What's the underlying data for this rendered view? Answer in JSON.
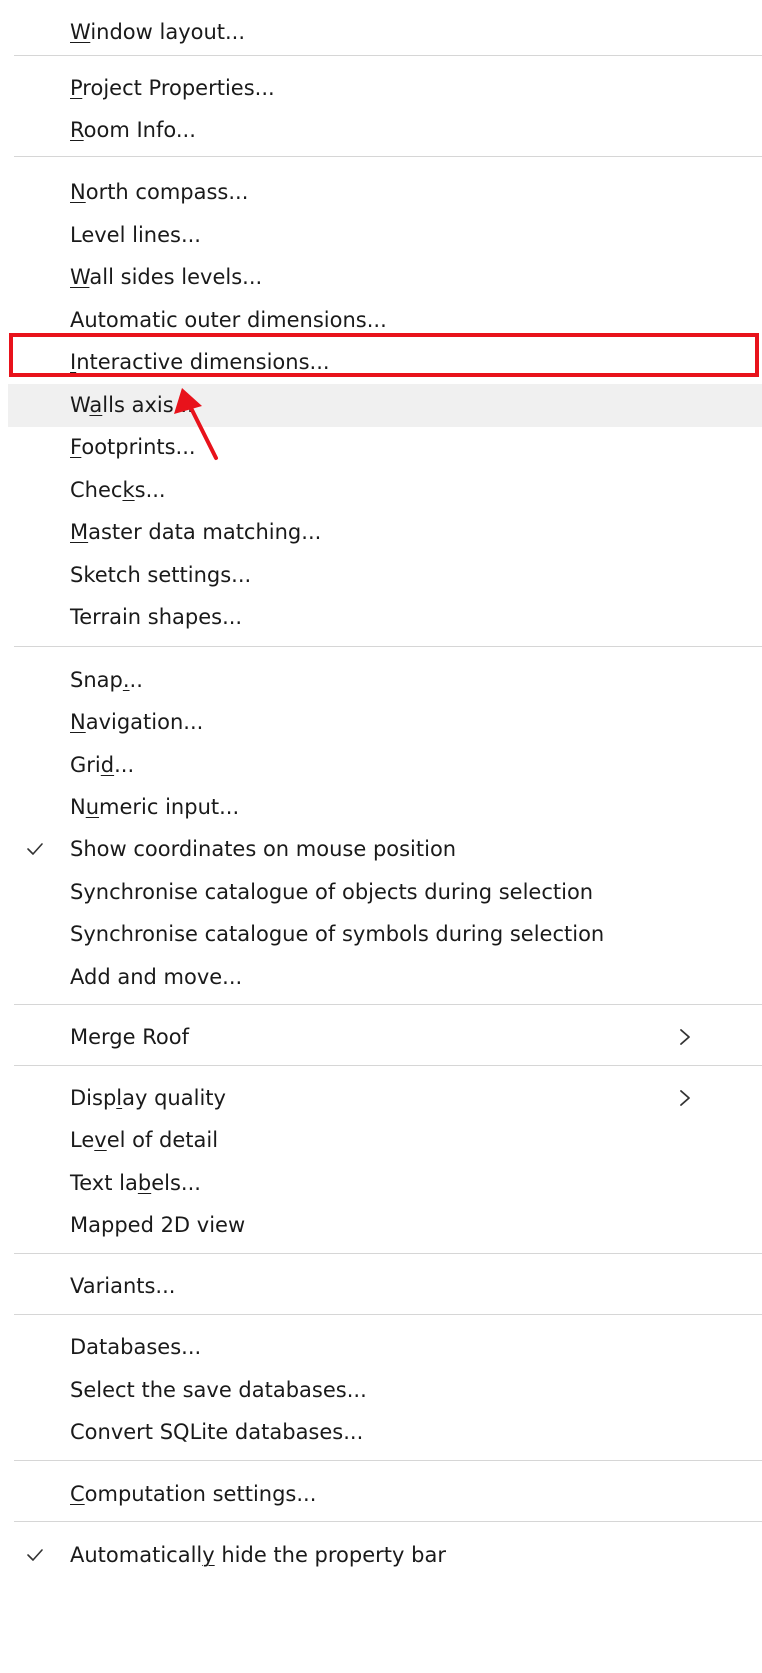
{
  "menu": {
    "items": [
      {
        "pre": "",
        "u": "W",
        "post": "indow layout...",
        "checked": false,
        "submenu": false,
        "hover": false
      },
      {
        "pre": "",
        "u": "P",
        "post": "roject Properties...",
        "checked": false,
        "submenu": false,
        "hover": false
      },
      {
        "pre": "",
        "u": "R",
        "post": "oom Info...",
        "checked": false,
        "submenu": false,
        "hover": false
      },
      {
        "pre": "",
        "u": "N",
        "post": "orth compass...",
        "checked": false,
        "submenu": false,
        "hover": false
      },
      {
        "pre": "Level lines...",
        "u": "",
        "post": "",
        "checked": false,
        "submenu": false,
        "hover": false
      },
      {
        "pre": "",
        "u": "W",
        "post": "all sides levels...",
        "checked": false,
        "submenu": false,
        "hover": false
      },
      {
        "pre": "Automatic outer dimensions...",
        "u": "",
        "post": "",
        "checked": false,
        "submenu": false,
        "hover": false
      },
      {
        "pre": "",
        "u": "I",
        "post": "nteractive dimensions...",
        "checked": false,
        "submenu": false,
        "hover": false
      },
      {
        "pre": "W",
        "u": "a",
        "post": "lls axis...",
        "checked": false,
        "submenu": false,
        "hover": true
      },
      {
        "pre": "",
        "u": "F",
        "post": "ootprints...",
        "checked": false,
        "submenu": false,
        "hover": false
      },
      {
        "pre": "Chec",
        "u": "k",
        "post": "s...",
        "checked": false,
        "submenu": false,
        "hover": false
      },
      {
        "pre": "",
        "u": "M",
        "post": "aster data matching...",
        "checked": false,
        "submenu": false,
        "hover": false
      },
      {
        "pre": "Sketch settings...",
        "u": "",
        "post": "",
        "checked": false,
        "submenu": false,
        "hover": false
      },
      {
        "pre": "Terrain shapes...",
        "u": "",
        "post": "",
        "checked": false,
        "submenu": false,
        "hover": false
      },
      {
        "pre": "Snap",
        "u": ".",
        "post": "..",
        "checked": false,
        "submenu": false,
        "hover": false
      },
      {
        "pre": "",
        "u": "N",
        "post": "avigation...",
        "checked": false,
        "submenu": false,
        "hover": false
      },
      {
        "pre": "Gri",
        "u": "d",
        "post": "...",
        "checked": false,
        "submenu": false,
        "hover": false
      },
      {
        "pre": "N",
        "u": "u",
        "post": "meric input...",
        "checked": false,
        "submenu": false,
        "hover": false
      },
      {
        "pre": "Show coordinates on mouse position",
        "u": "",
        "post": "",
        "checked": true,
        "submenu": false,
        "hover": false
      },
      {
        "pre": "Synchronise catalogue of objects during selection",
        "u": "",
        "post": "",
        "checked": false,
        "submenu": false,
        "hover": false
      },
      {
        "pre": "Synchronise catalogue of symbols during selection",
        "u": "",
        "post": "",
        "checked": false,
        "submenu": false,
        "hover": false
      },
      {
        "pre": "Add and move...",
        "u": "",
        "post": "",
        "checked": false,
        "submenu": false,
        "hover": false
      },
      {
        "pre": "Merge Roof",
        "u": "",
        "post": "",
        "checked": false,
        "submenu": true,
        "hover": false
      },
      {
        "pre": "Disp",
        "u": "l",
        "post": "ay quality",
        "checked": false,
        "submenu": true,
        "hover": false
      },
      {
        "pre": "Le",
        "u": "v",
        "post": "el of detail",
        "checked": false,
        "submenu": false,
        "hover": false
      },
      {
        "pre": "Text la",
        "u": "b",
        "post": "els...",
        "checked": false,
        "submenu": false,
        "hover": false
      },
      {
        "pre": "Mapped 2D view",
        "u": "",
        "post": "",
        "checked": false,
        "submenu": false,
        "hover": false
      },
      {
        "pre": "Variants...",
        "u": "",
        "post": "",
        "checked": false,
        "submenu": false,
        "hover": false
      },
      {
        "pre": "Databases...",
        "u": "",
        "post": "",
        "checked": false,
        "submenu": false,
        "hover": false
      },
      {
        "pre": "Select the save databases...",
        "u": "",
        "post": "",
        "checked": false,
        "submenu": false,
        "hover": false
      },
      {
        "pre": "Convert SQLite databases...",
        "u": "",
        "post": "",
        "checked": false,
        "submenu": false,
        "hover": false
      },
      {
        "pre": "",
        "u": "C",
        "post": "omputation settings...",
        "checked": false,
        "submenu": false,
        "hover": false
      },
      {
        "pre": "Automaticall",
        "u": "y",
        "post": " hide the property bar",
        "checked": true,
        "submenu": false,
        "hover": false
      }
    ]
  },
  "annotation": {
    "highlighted_item": "Interactive dimensions...",
    "highlight_color": "#e8121b"
  },
  "colors": {
    "hover_background": "#f0f0f0",
    "separator": "#d6d6d6",
    "text": "#1a1a1a"
  }
}
